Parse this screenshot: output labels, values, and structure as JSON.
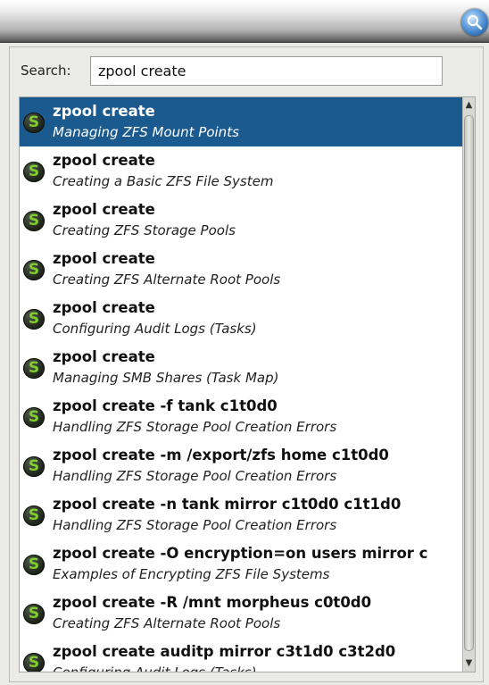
{
  "search": {
    "label": "Search:",
    "value": "zpool create"
  },
  "results": [
    {
      "command": "zpool create",
      "topic": "Managing ZFS Mount Points",
      "selected": true
    },
    {
      "command": "zpool create",
      "topic": "Creating a Basic ZFS File System"
    },
    {
      "command": "zpool create",
      "topic": "Creating ZFS Storage Pools"
    },
    {
      "command": "zpool create",
      "topic": "Creating ZFS Alternate Root Pools"
    },
    {
      "command": "zpool create",
      "topic": "Configuring Audit Logs (Tasks)"
    },
    {
      "command": "zpool create",
      "topic": "Managing SMB Shares (Task Map)"
    },
    {
      "command": "zpool create -f tank c1t0d0",
      "topic": "Handling ZFS Storage Pool Creation Errors"
    },
    {
      "command": "zpool create -m /export/zfs home c1t0d0",
      "topic": "Handling ZFS Storage Pool Creation Errors"
    },
    {
      "command": "zpool create -n tank mirror c1t0d0 c1t1d0",
      "topic": "Handling ZFS Storage Pool Creation Errors"
    },
    {
      "command": "zpool create -O encryption=on users mirror c",
      "topic": "Examples of Encrypting ZFS File Systems"
    },
    {
      "command": "zpool create -R /mnt morpheus c0t0d0",
      "topic": "Creating ZFS Alternate Root Pools"
    },
    {
      "command": "zpool create auditp mirror c3t1d0 c3t2d0",
      "topic": "Configuring Audit Logs (Tasks)"
    }
  ],
  "result_icon": {
    "name": "script-s-icon",
    "glyph": "S",
    "color": "#7fce2d"
  },
  "scrollbar": {
    "up_glyph": "▲",
    "down_glyph": "▼"
  },
  "colors": {
    "selection": "#1b5a8e",
    "accent": "#2c6db8"
  }
}
